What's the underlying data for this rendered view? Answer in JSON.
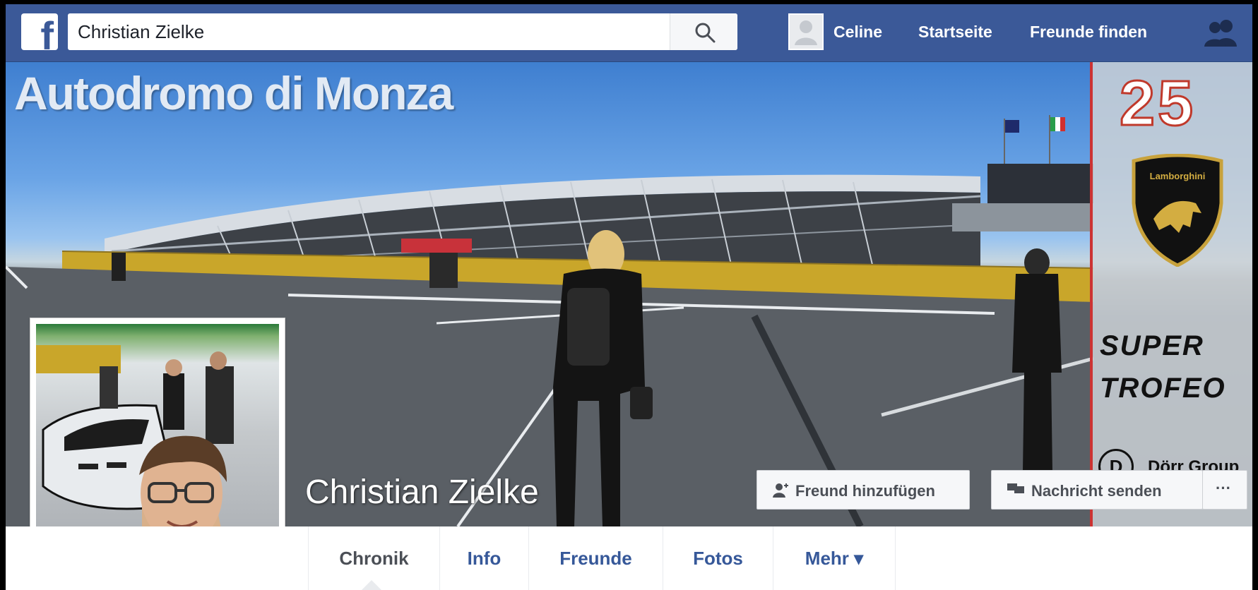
{
  "topbar": {
    "logo": "facebook-logo",
    "logo_letter": "f",
    "search_value": "Christian Zielke",
    "search_icon": "search-icon",
    "user_name": "Celine",
    "home_label": "Startseite",
    "find_friends_label": "Freunde finden",
    "friend_requests_icon": "friends-icon",
    "brand_color": "#3b5998"
  },
  "cover": {
    "title": "Autodromo di Monza",
    "profile_name": "Christian Zielke",
    "sponsor": {
      "number": "25",
      "brand_1": "Lamborghini",
      "brand_2_line1": "SUPER",
      "brand_2_line2": "TROFEO",
      "brand_3_logo": "D",
      "brand_3": "Dörr Group"
    }
  },
  "actions": {
    "add_friend_icon": "add-friend-icon",
    "add_friend_label": "Freund hinzufügen",
    "message_icon": "message-icon",
    "message_label": "Nachricht senden",
    "more_label": "···"
  },
  "tabs": [
    {
      "label": "Chronik",
      "active": true
    },
    {
      "label": "Info"
    },
    {
      "label": "Freunde"
    },
    {
      "label": "Fotos"
    },
    {
      "label": "Mehr ▾"
    }
  ]
}
